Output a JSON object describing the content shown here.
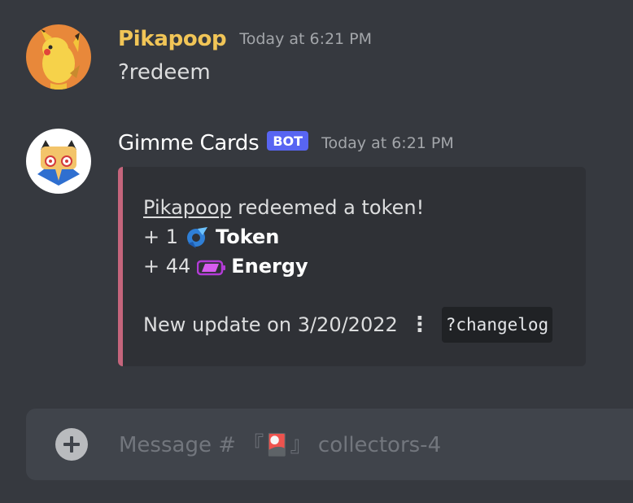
{
  "messages": [
    {
      "author": "Pikapoop",
      "timestamp": "Today at 6:21 PM",
      "content": "?redeem",
      "avatar_icon": "pikachu-avatar"
    },
    {
      "author": "Gimme Cards",
      "bot_tag": "BOT",
      "timestamp": "Today at 6:21 PM",
      "avatar_icon": "gimme-cards-bot-avatar",
      "embed": {
        "accent_color": "#c5657c",
        "mention": "Pikapoop",
        "redeem_text": " redeemed a token!",
        "token_amount": "+ 1",
        "token_icon": "token-icon",
        "token_label": "Token",
        "energy_amount": "+ 44",
        "energy_icon": "energy-battery-icon",
        "energy_label": "Energy",
        "update_text": "New update on 3/20/2022",
        "separator": "⋮",
        "changelog_command": "?changelog"
      }
    }
  ],
  "composer": {
    "placeholder": "Message # 『🎴』 collectors-4",
    "add_icon": "plus-circle-icon"
  },
  "colors": {
    "background": "#36393f",
    "embed_background": "#2f3136",
    "user_name": "#f1c557",
    "bot_tag": "#5865f2"
  }
}
